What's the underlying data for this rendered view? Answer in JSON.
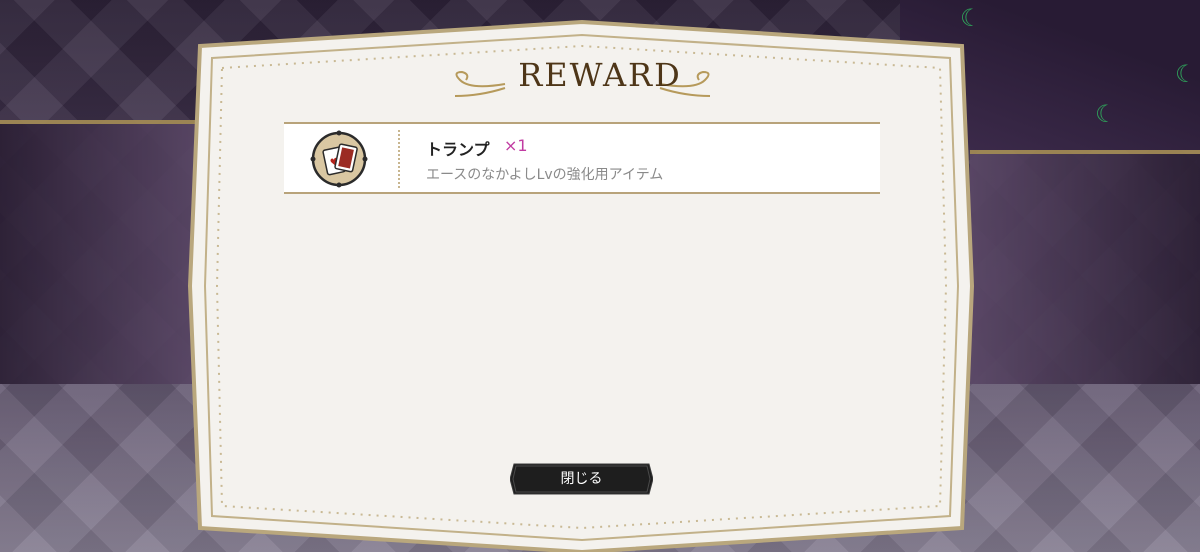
{
  "dialog": {
    "title": "REWARD"
  },
  "reward_items": [
    {
      "name": "トランプ",
      "quantity": "×1",
      "description": "エースのなかよしLvの強化用アイテム",
      "icon": "playing-cards-icon"
    }
  ],
  "buttons": {
    "close_label": "閉じる"
  },
  "colors": {
    "frame_gold": "#b9a77d",
    "panel_bg": "#f4f2ee",
    "title_brown": "#4e3618",
    "quantity_magenta": "#c13ba2",
    "button_dark": "#1e1e1e"
  }
}
